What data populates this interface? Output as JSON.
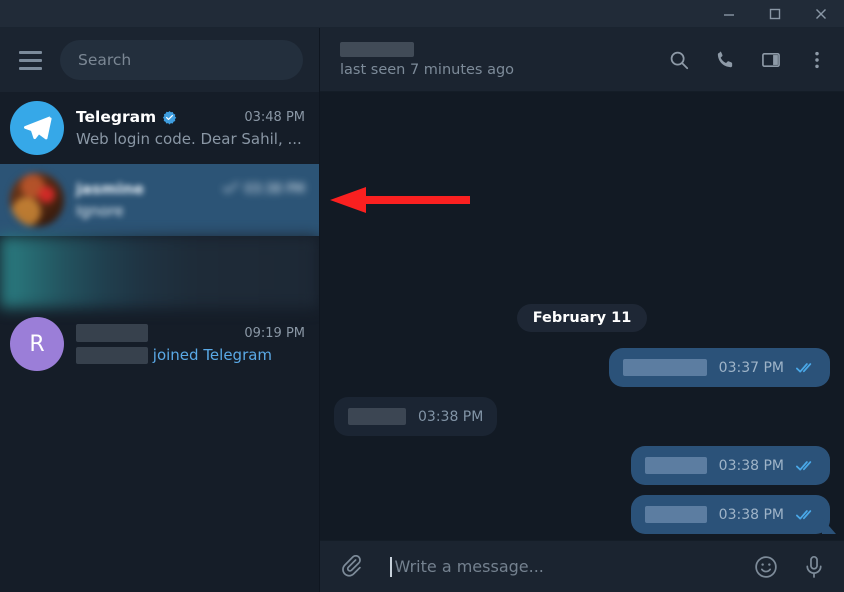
{
  "window": {
    "minimize_label": "Minimize",
    "maximize_label": "Maximize",
    "close_label": "Close"
  },
  "sidebar": {
    "menu_icon": "hamburger-menu-icon",
    "search": {
      "placeholder": "Search",
      "value": ""
    },
    "chats": [
      {
        "name": "Telegram",
        "verified": true,
        "time": "03:48 PM",
        "preview": "Web login code. Dear Sahil, ...",
        "avatar_type": "telegram-logo",
        "avatar_letter": "",
        "selected": false,
        "redacted": false
      },
      {
        "name": "jasmine",
        "verified": false,
        "time": "03:38 PM",
        "preview": "Ignore",
        "avatar_type": "photo",
        "avatar_letter": "",
        "selected": true,
        "redacted": true
      },
      {
        "name": "",
        "verified": false,
        "time": "",
        "preview": "",
        "avatar_type": "blurred",
        "avatar_letter": "",
        "selected": false,
        "redacted": true
      },
      {
        "name": "",
        "verified": false,
        "time": "09:19 PM",
        "preview": "joined Telegram",
        "avatar_type": "letter",
        "avatar_letter": "R",
        "selected": false,
        "redacted": true
      }
    ]
  },
  "chat": {
    "header": {
      "title": "",
      "status": "last seen 7 minutes ago",
      "actions": [
        {
          "name": "search-icon",
          "label": "Search"
        },
        {
          "name": "phone-icon",
          "label": "Call"
        },
        {
          "name": "split-panel-icon",
          "label": "Toggle info panel"
        },
        {
          "name": "more-vertical-icon",
          "label": "More"
        }
      ]
    },
    "date_divider": "February 11",
    "messages": [
      {
        "direction": "out",
        "text": "",
        "time": "03:37 PM",
        "status": "read",
        "tail": false
      },
      {
        "direction": "in",
        "text": "",
        "time": "03:38 PM",
        "status": "",
        "tail": false
      },
      {
        "direction": "out",
        "text": "",
        "time": "03:38 PM",
        "status": "read",
        "tail": false
      },
      {
        "direction": "out",
        "text": "",
        "time": "03:38 PM",
        "status": "read",
        "tail": true
      }
    ],
    "composer": {
      "attach_label": "Attach file",
      "placeholder": "Write a message...",
      "value": "",
      "emoji_label": "Emoji",
      "voice_label": "Record voice message"
    }
  },
  "annotation": {
    "type": "arrow-left",
    "color": "#fa2020"
  },
  "colors": {
    "accent": "#36a8e8",
    "selected_row": "#2c5476",
    "out_bubble": "#2b5279",
    "in_bubble": "#1b2533",
    "titlebar": "#212b38",
    "sidebar_bg": "#151d28",
    "chat_bg": "#121a24",
    "tick_blue": "#4aa8e8",
    "arrow_red": "#fa2020"
  }
}
